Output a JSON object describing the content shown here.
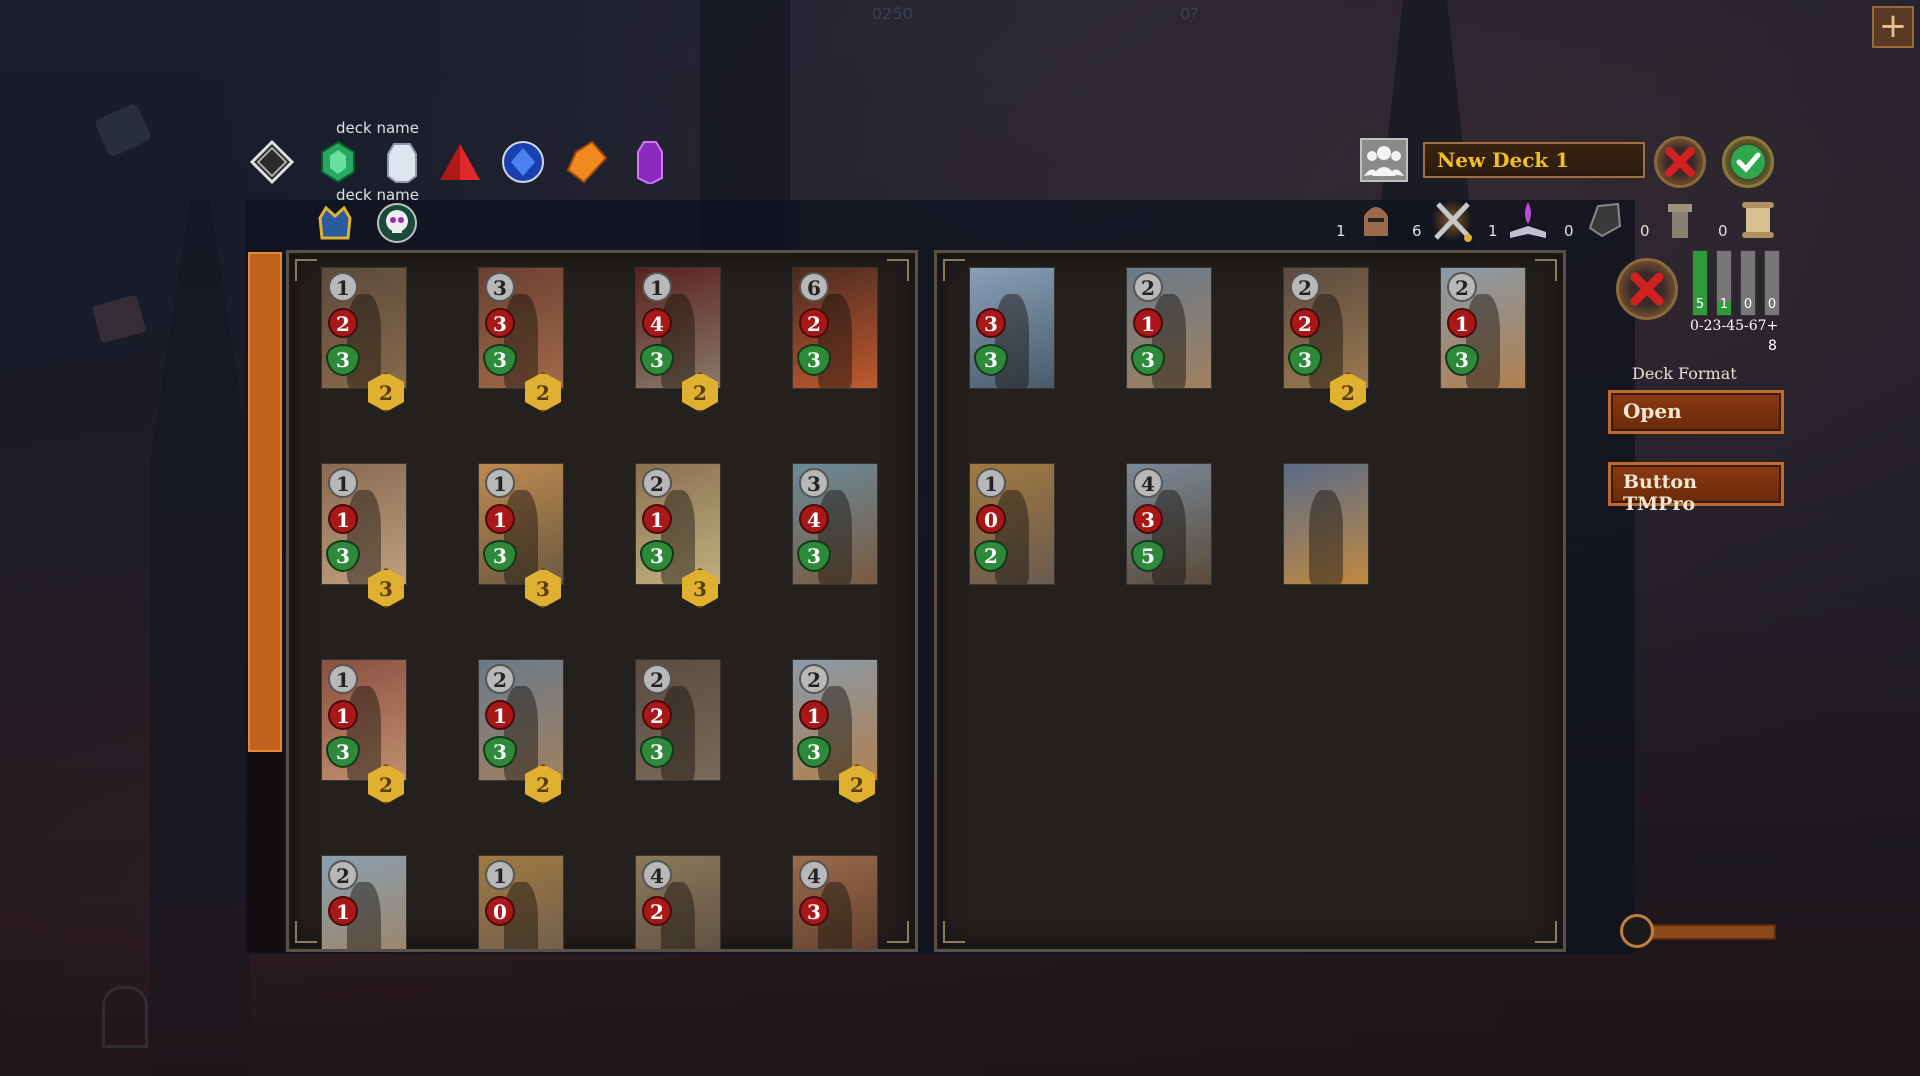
{
  "filters": {
    "deck_name_label_1": "deck name",
    "deck_name_label_2": "deck name",
    "gems": [
      {
        "icon": "colorless-diamond-icon",
        "color": "#d0d0d0"
      },
      {
        "icon": "green-emerald-icon",
        "color": "#30b060"
      },
      {
        "icon": "white-crystal-icon",
        "color": "#dde6ee"
      },
      {
        "icon": "red-pyramid-icon",
        "color": "#c02020"
      },
      {
        "icon": "blue-sapphire-icon",
        "color": "#2050d0"
      },
      {
        "icon": "orange-amber-icon",
        "color": "#f08a20"
      },
      {
        "icon": "purple-amethyst-icon",
        "color": "#9a3ad0"
      }
    ],
    "faction_icons": [
      "crowned-helm-icon",
      "skull-icon"
    ]
  },
  "header": {
    "deck_name": "New Deck 1",
    "faint_top_text_1": "0250",
    "faint_top_text_2": "0?"
  },
  "class_filters": [
    {
      "icon": "knight-helmet-icon",
      "count": "1"
    },
    {
      "icon": "crossed-weapons-icon",
      "count": "6"
    },
    {
      "icon": "spellbook-icon",
      "count": "1"
    },
    {
      "icon": "rune-stone-icon",
      "count": "0"
    },
    {
      "icon": "tower-icon",
      "count": "0"
    },
    {
      "icon": "scroll-icon",
      "count": "0"
    }
  ],
  "collection_cards": [
    {
      "cost": "1",
      "atk": "2",
      "hp": "3",
      "count": "2",
      "colors": [
        "#5a4a3a",
        "#8a6a4a"
      ]
    },
    {
      "cost": "3",
      "atk": "3",
      "hp": "3",
      "count": "2",
      "colors": [
        "#6a4030",
        "#a06a4a"
      ]
    },
    {
      "cost": "1",
      "atk": "4",
      "hp": "3",
      "count": "2",
      "colors": [
        "#5a2020",
        "#8a7a6a"
      ]
    },
    {
      "cost": "6",
      "atk": "2",
      "hp": "3",
      "count": "",
      "colors": [
        "#4a2a20",
        "#c05a30"
      ]
    },
    {
      "cost": "1",
      "atk": "1",
      "hp": "3",
      "count": "3",
      "colors": [
        "#8a6a50",
        "#c0a080"
      ]
    },
    {
      "cost": "1",
      "atk": "1",
      "hp": "3",
      "count": "3",
      "colors": [
        "#c08a50",
        "#6a5a40"
      ]
    },
    {
      "cost": "2",
      "atk": "1",
      "hp": "3",
      "count": "3",
      "colors": [
        "#8a7050",
        "#c0b080"
      ]
    },
    {
      "cost": "3",
      "atk": "4",
      "hp": "3",
      "count": "",
      "colors": [
        "#6a8a9a",
        "#7a5a40"
      ]
    },
    {
      "cost": "1",
      "atk": "1",
      "hp": "3",
      "count": "2",
      "colors": [
        "#8a5040",
        "#c09070"
      ]
    },
    {
      "cost": "2",
      "atk": "1",
      "hp": "3",
      "count": "2",
      "colors": [
        "#6a7a8a",
        "#a08060"
      ]
    },
    {
      "cost": "2",
      "atk": "2",
      "hp": "3",
      "count": "",
      "colors": [
        "#5a4a40",
        "#7a6a5a"
      ]
    },
    {
      "cost": "2",
      "atk": "1",
      "hp": "3",
      "count": "2",
      "colors": [
        "#8a9aa8",
        "#b08050"
      ]
    },
    {
      "cost": "2",
      "atk": "1",
      "hp": "",
      "count": "",
      "colors": [
        "#8aa0b0",
        "#a08060"
      ]
    },
    {
      "cost": "1",
      "atk": "0",
      "hp": "",
      "count": "",
      "colors": [
        "#a07a40",
        "#6a5a50"
      ]
    },
    {
      "cost": "4",
      "atk": "2",
      "hp": "",
      "count": "",
      "colors": [
        "#8a7a5a",
        "#5a4a40"
      ]
    },
    {
      "cost": "4",
      "atk": "3",
      "hp": "",
      "count": "",
      "colors": [
        "#9a6a4a",
        "#5a3a2a"
      ]
    }
  ],
  "deck_cards": [
    {
      "cost": "",
      "atk": "3",
      "hp": "3",
      "count": "",
      "colors": [
        "#8aa0b8",
        "#4a5a6a"
      ]
    },
    {
      "cost": "2",
      "atk": "1",
      "hp": "3",
      "count": "",
      "colors": [
        "#6a7a8a",
        "#a08060"
      ]
    },
    {
      "cost": "2",
      "atk": "2",
      "hp": "3",
      "count": "2",
      "colors": [
        "#5a4a40",
        "#9a7a50"
      ]
    },
    {
      "cost": "2",
      "atk": "1",
      "hp": "3",
      "count": "",
      "colors": [
        "#8a9aa8",
        "#b08050"
      ]
    },
    {
      "cost": "1",
      "atk": "0",
      "hp": "2",
      "count": "",
      "colors": [
        "#a07a40",
        "#6a5a50"
      ]
    },
    {
      "cost": "4",
      "atk": "3",
      "hp": "5",
      "count": "",
      "colors": [
        "#7a8a9a",
        "#5a4a3a"
      ]
    },
    {
      "cost": "",
      "atk": "",
      "hp": "",
      "count": "",
      "colors": [
        "#5a6a8a",
        "#c08a40"
      ]
    }
  ],
  "mana_curve": {
    "bars": [
      {
        "count": "5",
        "fill": 1.0
      },
      {
        "count": "1",
        "fill": 0.2
      },
      {
        "count": "0",
        "fill": 0.0
      },
      {
        "count": "0",
        "fill": 0.0
      }
    ],
    "labels": "0-23-45-67+",
    "total": "8"
  },
  "deck_format": {
    "label": "Deck Format",
    "value": "Open"
  },
  "button_tmpro_label": "Button TMPro",
  "zoom_slider": {
    "value": 0.0
  },
  "colors": {
    "accent_orange": "#c0621e",
    "gold_text": "#f0c020",
    "confirm_green": "#2ea84a",
    "cancel_red": "#d02020"
  }
}
